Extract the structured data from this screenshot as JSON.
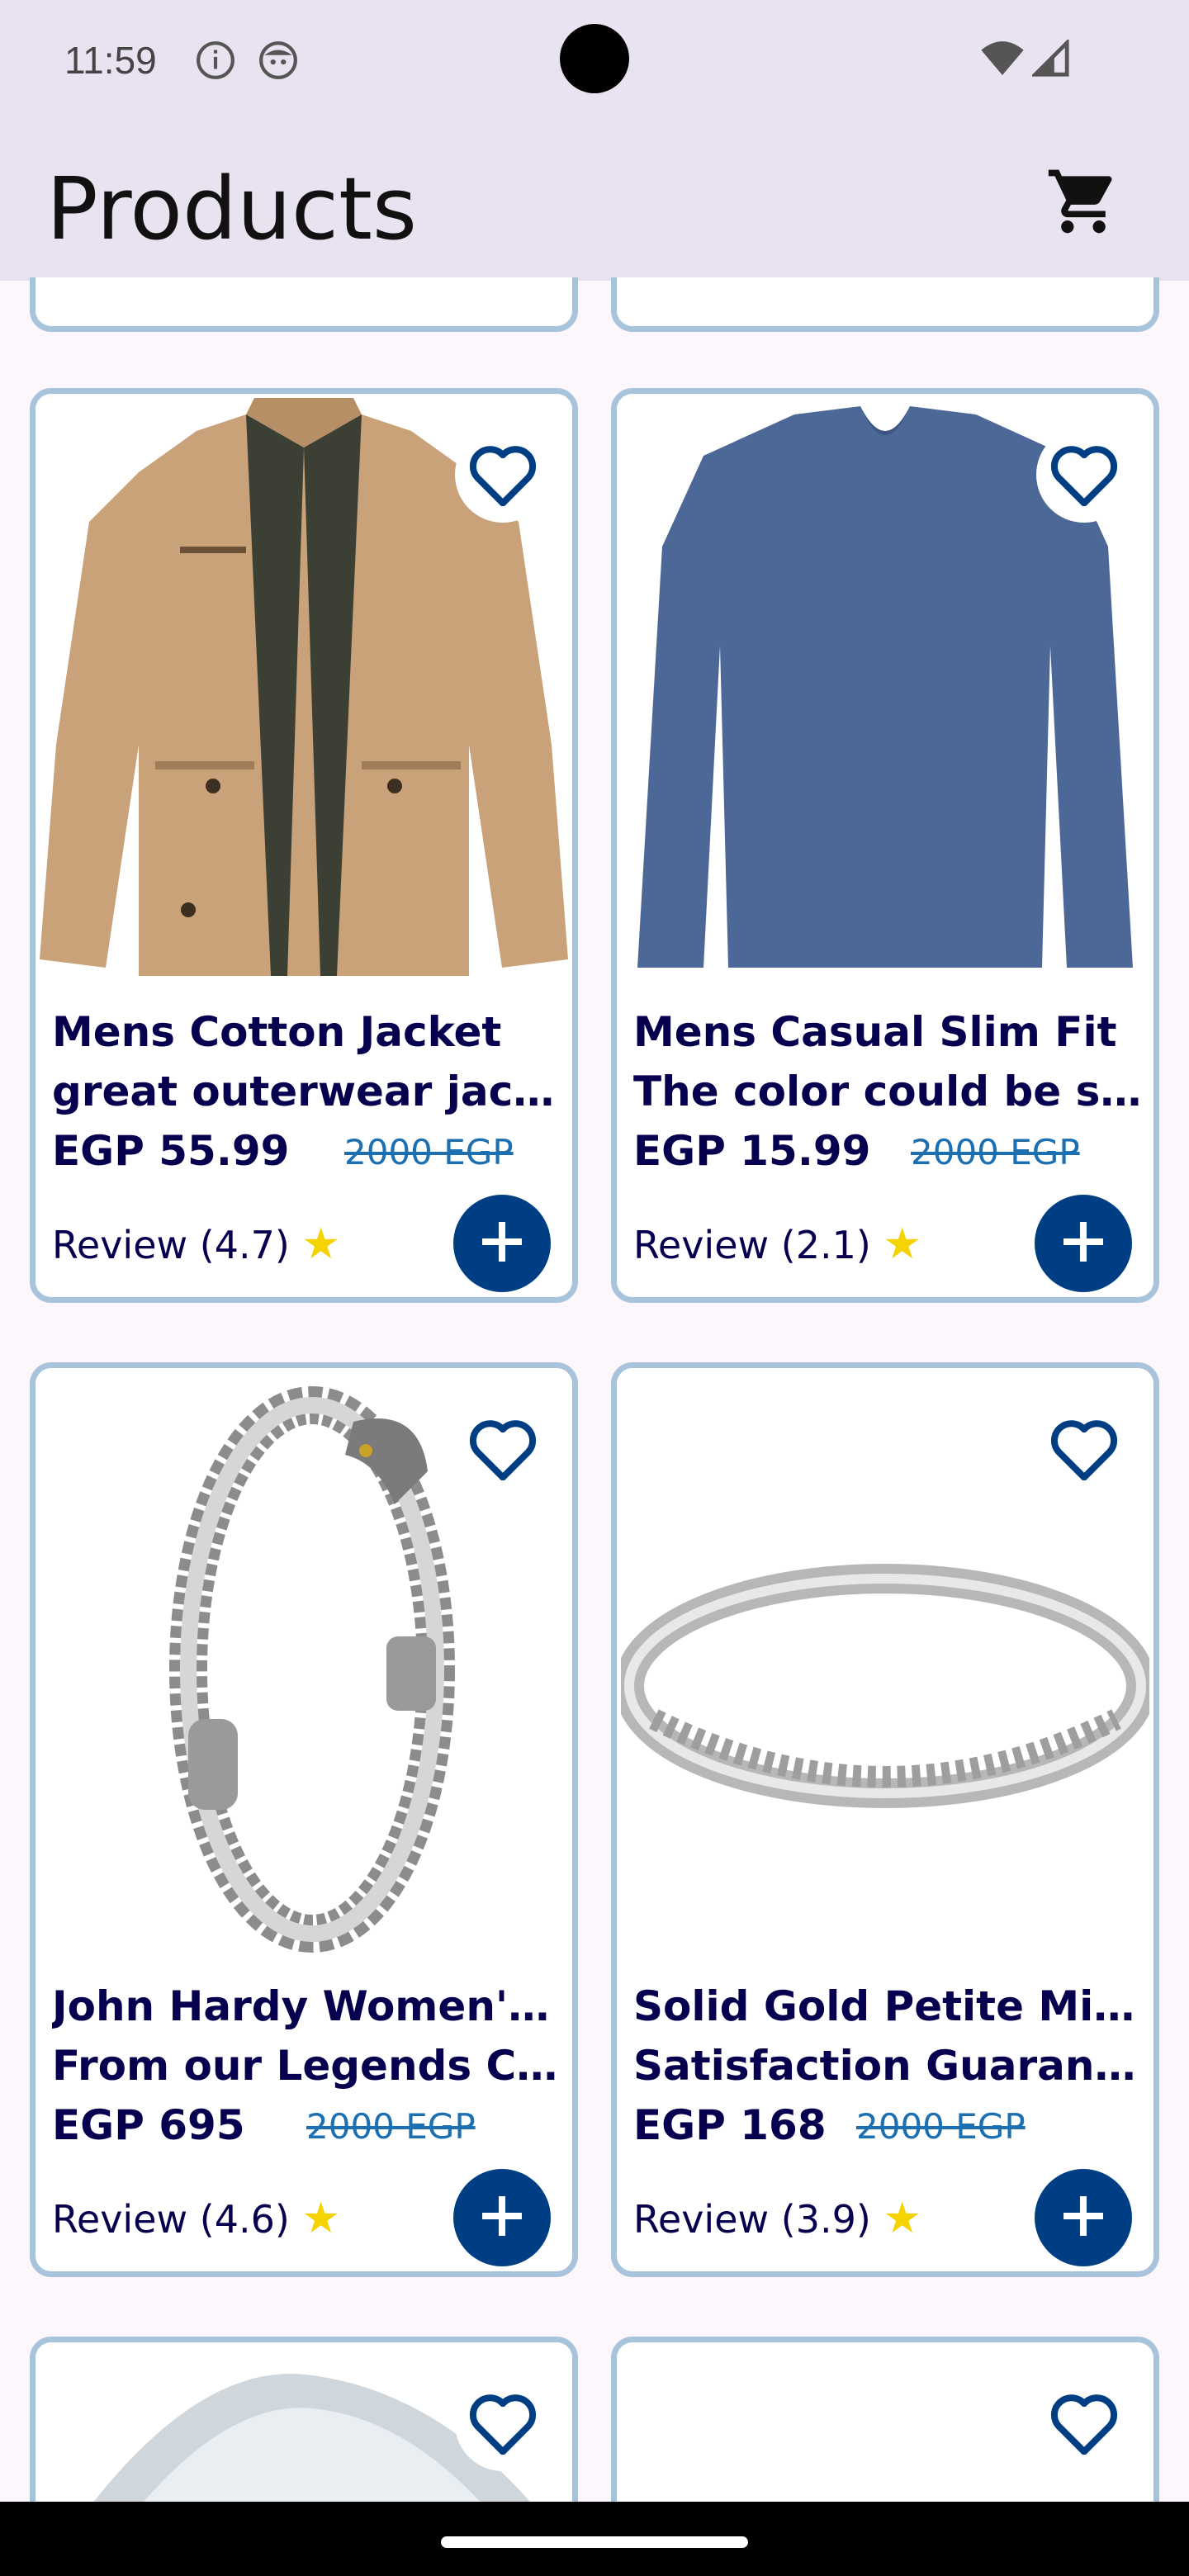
{
  "status_bar": {
    "time": "11:59"
  },
  "app_bar": {
    "title": "Products"
  },
  "products": [
    {
      "title_line1": "Mens Cotton Jacket",
      "title_line2": "great outerwear jack...",
      "price": "EGP 55.99",
      "old_price": "2000 EGP",
      "review": "Review (4.7)"
    },
    {
      "title_line1": "Mens Casual Slim Fit",
      "title_line2": "The color could be sli...",
      "price": "EGP 15.99",
      "old_price": "2000 EGP",
      "review": "Review (2.1)"
    },
    {
      "title_line1": "John Hardy Women's ...",
      "title_line2": "From our Legends Col...",
      "price": "EGP 695",
      "old_price": "2000 EGP",
      "review": "Review (4.6)"
    },
    {
      "title_line1": "Solid Gold Petite Micr...",
      "title_line2": "Satisfaction Guarant...",
      "price": "EGP 168",
      "old_price": "2000 EGP",
      "review": "Review (3.9)"
    }
  ],
  "colors": {
    "accent": "#003e84",
    "card_border": "#a8c3dc",
    "text": "#06004f",
    "old_price": "#1c6fb1",
    "star": "#f5d300",
    "app_bar": "#e9e2f1"
  },
  "icons": [
    "info-icon",
    "face-icon",
    "wifi-icon",
    "signal-icon",
    "cart-icon",
    "heart-outline-icon",
    "plus-icon",
    "star-icon"
  ]
}
